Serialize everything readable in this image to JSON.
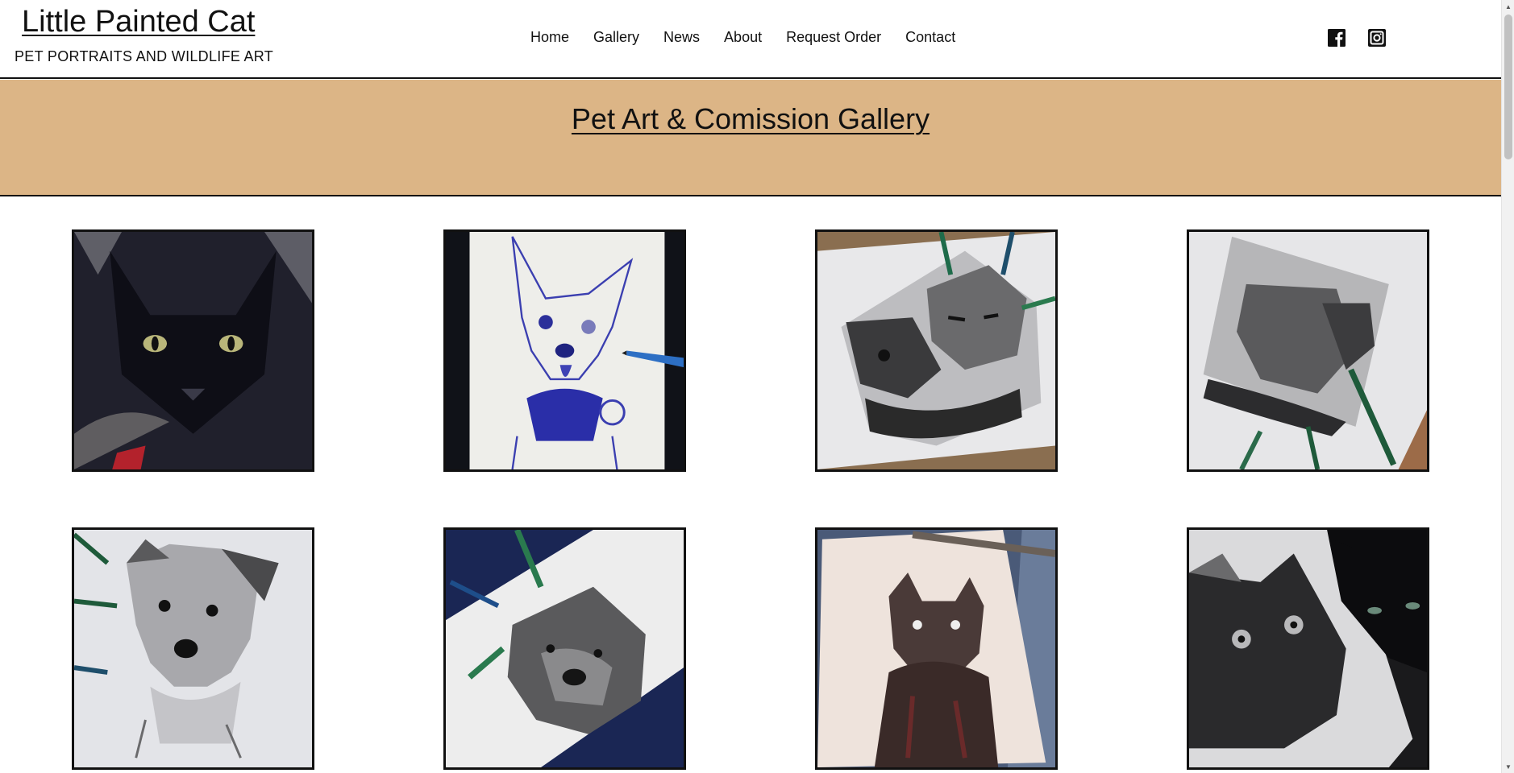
{
  "site": {
    "title": "Little Painted Cat",
    "tagline": "PET PORTRAITS AND WILDLIFE ART"
  },
  "nav": {
    "items": [
      {
        "label": "Home"
      },
      {
        "label": "Gallery"
      },
      {
        "label": "News"
      },
      {
        "label": "About"
      },
      {
        "label": "Request Order"
      },
      {
        "label": "Contact"
      }
    ]
  },
  "social": {
    "icons": [
      "facebook-icon",
      "instagram-icon"
    ]
  },
  "banner": {
    "title": "Pet Art & Comission Gallery",
    "color": "#dcb586"
  },
  "gallery": {
    "items": [
      {
        "subject": "black-cat-colored-pencil-portrait"
      },
      {
        "subject": "dog-blue-ballpoint-sketch"
      },
      {
        "subject": "two-cats-graphite-drawing"
      },
      {
        "subject": "cats-graphite-drawing-with-pencils"
      },
      {
        "subject": "terrier-graphite-drawing"
      },
      {
        "subject": "old-dog-graphite-drawing"
      },
      {
        "subject": "longhair-cat-ink-drawing"
      },
      {
        "subject": "cat-drawing-beside-black-cat"
      }
    ]
  }
}
